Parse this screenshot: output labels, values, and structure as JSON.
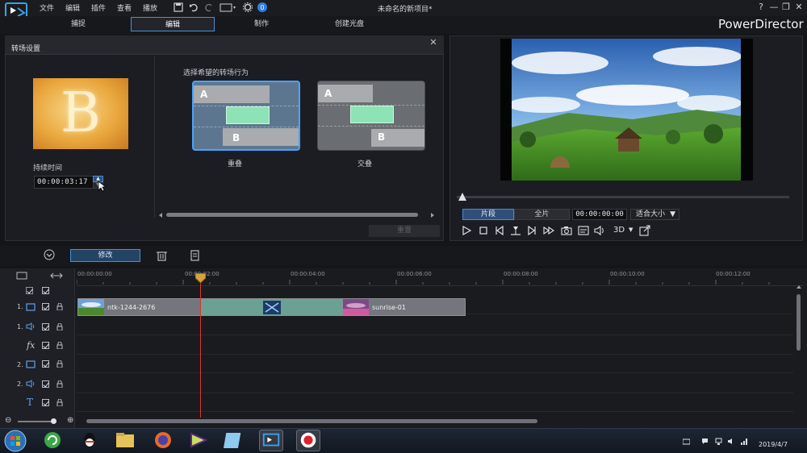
{
  "app": {
    "title": "未命名的新项目*",
    "brand": "PowerDirector",
    "menu": [
      "文件",
      "编辑",
      "插件",
      "查看",
      "播放"
    ],
    "window_controls": [
      "?",
      "—",
      "❐",
      "✕"
    ]
  },
  "mode_tabs": [
    {
      "label": "捕捉",
      "active": false
    },
    {
      "label": "编辑",
      "active": true
    },
    {
      "label": "制作",
      "active": false
    },
    {
      "label": "创建光盘",
      "active": false
    }
  ],
  "transition_panel": {
    "title": "转场设置",
    "thumbnail_letter": "B",
    "duration_label": "持续时间",
    "duration_value": "00:00:03:17",
    "behavior_label": "选择希望的转场行为",
    "options": [
      {
        "label": "重叠",
        "selected": true,
        "a": "A",
        "b": "B"
      },
      {
        "label": "交叠",
        "selected": false,
        "a": "A",
        "b": "B"
      }
    ],
    "reset_label": "重置"
  },
  "preview": {
    "clip_tab": "片段",
    "full_tab": "全片",
    "timecode": "00:00:00:00",
    "fit_label": "适合大小",
    "mode_3d": "3D"
  },
  "toolbar": {
    "modify_label": "修改"
  },
  "timeline": {
    "ruler": [
      "00:00:00:00",
      "00:00:02:00",
      "00:00:04:00",
      "00:00:06:00",
      "00:00:08:00",
      "00:00:10:00",
      "00:00:12:00"
    ],
    "tracks": [
      {
        "num": "",
        "type": "master"
      },
      {
        "num": "1.",
        "type": "video"
      },
      {
        "num": "1.",
        "type": "audio"
      },
      {
        "num": "",
        "type": "fx"
      },
      {
        "num": "2.",
        "type": "video"
      },
      {
        "num": "2.",
        "type": "audio"
      },
      {
        "num": "",
        "type": "title"
      }
    ],
    "clips": [
      {
        "label": "ntk-1244-2676"
      },
      {
        "label": "sunrise-01"
      }
    ]
  },
  "taskbar": {
    "date": "2019/4/7"
  }
}
